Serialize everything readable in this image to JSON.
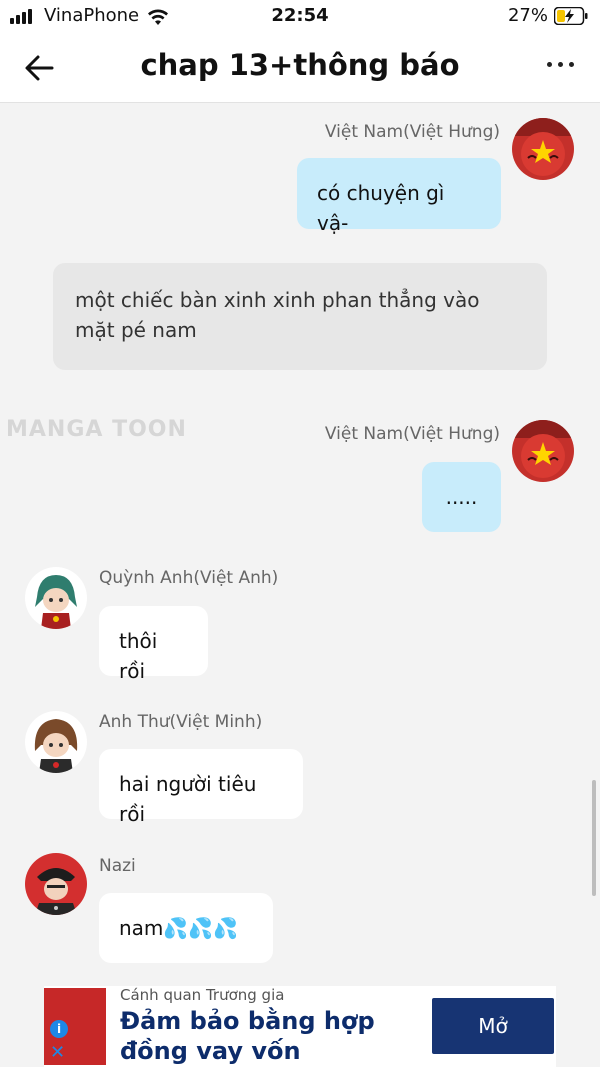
{
  "status_bar": {
    "carrier": "VinaPhone",
    "time": "22:54",
    "battery": "27%"
  },
  "header": {
    "title": "chap 13+thông báo"
  },
  "watermark": "MANGA TOON",
  "messages": [
    {
      "sender": "Việt Nam(Việt Hưng)",
      "text": "có chuyện gì vậ-"
    },
    {
      "text": "một chiếc bàn xinh xinh phan thẳng vào mặt pé nam"
    },
    {
      "sender": "Việt Nam(Việt Hưng)",
      "text": "....."
    },
    {
      "sender": "Quỳnh Anh(Việt Anh)",
      "text": "thôi rồi"
    },
    {
      "sender": "Anh Thư(Việt Minh)",
      "text": "hai người tiêu rồi"
    },
    {
      "sender": "Nazi",
      "text": "nam💦💦💦"
    }
  ],
  "ad": {
    "source": "Cánh quan Trương gia",
    "headline": "Đảm bảo bằng hợp đồng vay vốn",
    "cta": "Mở",
    "accent": "#173473"
  }
}
